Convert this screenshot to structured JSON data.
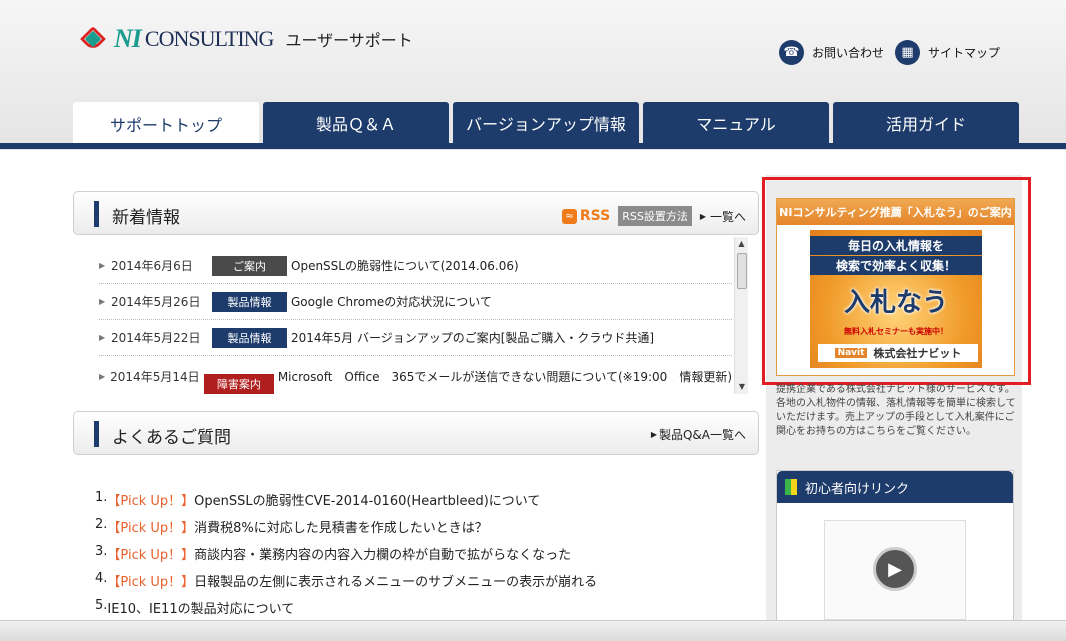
{
  "header": {
    "logo_ni": "NI",
    "logo_consulting": "CONSULTING",
    "logo_subtitle": "ユーザーサポート",
    "contact": "お問い合わせ",
    "sitemap": "サイトマップ",
    "contact_icon": "phone-icon",
    "sitemap_icon": "sitemap-icon"
  },
  "nav": {
    "tabs": [
      {
        "label": "サポートトップ",
        "active": true
      },
      {
        "label": "製品Ｑ＆Ａ",
        "active": false
      },
      {
        "label": "バージョンアップ情報",
        "active": false
      },
      {
        "label": "マニュアル",
        "active": false
      },
      {
        "label": "活用ガイド",
        "active": false
      }
    ]
  },
  "news": {
    "title": "新着情報",
    "rss": "RSS",
    "rss_setup": "RSS設置方法",
    "list_link": "一覧へ",
    "items": [
      {
        "date": "2014年6月6日",
        "badge": "ご案内",
        "badge_color": "#4a4a4a",
        "text": "OpenSSLの脆弱性について(2014.06.06)"
      },
      {
        "date": "2014年5月26日",
        "badge": "製品情報",
        "badge_color": "#1d3b6b",
        "text": "Google Chromeの対応状況について"
      },
      {
        "date": "2014年5月22日",
        "badge": "製品情報",
        "badge_color": "#1d3b6b",
        "text": "2014年5月 バージョンアップのご案内[製品ご購入・クラウド共通]"
      },
      {
        "date": "2014年5月14日",
        "badge": "障害案内",
        "badge_color": "#b01e1e",
        "text": "Microsoft　Office　365でメールが送信できない問題について(※19:00　情報更新)"
      }
    ]
  },
  "faq": {
    "title": "よくあるご質問",
    "list_link": "製品Q&A一覧へ",
    "items": [
      {
        "num": "1.",
        "pick": "【Pick Up！】",
        "text": "OpenSSLの脆弱性CVE-2014-0160(Heartbleed)について"
      },
      {
        "num": "2.",
        "pick": "【Pick Up！】",
        "text": "消費税8%に対応した見積書を作成したいときは？"
      },
      {
        "num": "3.",
        "pick": "【Pick Up！】",
        "text": "商談内容・業務内容の内容入力欄の枠が自動で拡がらなくなった"
      },
      {
        "num": "4.",
        "pick": "【Pick Up！】",
        "text": "日報製品の左側に表示されるメニューのサブメニューの表示が崩れる"
      },
      {
        "num": "5.",
        "pick": "",
        "text": "IE10、IE11の製品対応について"
      }
    ]
  },
  "sidebar": {
    "ad_header": "NIコンサルティング推薦「入札なう」のご案内",
    "ad_line1": "毎日の入札情報を",
    "ad_line2": "検索で効率よく収集！",
    "ad_main": "入札なう",
    "ad_small": "無料入札セミナーも実施中！",
    "ad_navit": "Navit",
    "ad_company": "株式会社ナビット",
    "description": "提携企業である株式会社ナビット様のサービスです。各地の入札物件の情報、落札情報等を簡単に検索していただけます。売上アップの手段として入札案件にご関心をお持ちの方はこちらをご覧ください。",
    "beginner_title": "初心者向けリンク"
  },
  "colors": {
    "brand_navy": "#1d3b6b",
    "accent_orange": "#e8602c",
    "highlight_red": "#e21d24"
  }
}
